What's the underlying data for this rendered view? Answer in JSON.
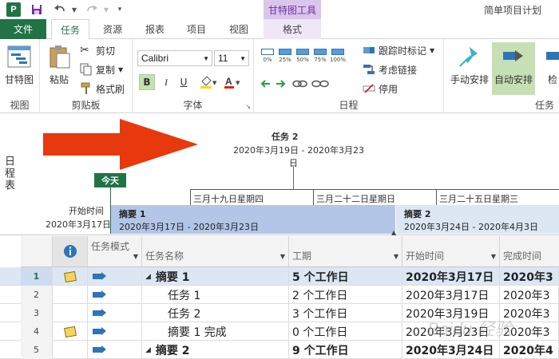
{
  "titlebar": {
    "app_logo": "P",
    "qat_icons": [
      "save-icon",
      "undo-icon",
      "redo-icon",
      "customize-icon"
    ],
    "context_tab_title": "甘特图工具",
    "document_title": "简单项目计划"
  },
  "tabs": {
    "file": "文件",
    "task": "任务",
    "resource": "资源",
    "report": "报表",
    "project": "项目",
    "view": "视图",
    "format": "格式"
  },
  "ribbon": {
    "view_group": {
      "gantt_label": "甘特图",
      "group_label": "视图"
    },
    "clipboard_group": {
      "paste": "粘贴",
      "cut": "剪切",
      "copy": "复制",
      "format_painter": "格式刷",
      "group_label": "剪贴板"
    },
    "font_group": {
      "font_name": "Calibri",
      "font_size": "11",
      "bold": "B",
      "italic": "I",
      "underline": "U",
      "group_label": "字体"
    },
    "schedule_group": {
      "percents": [
        "0%",
        "25%",
        "50%",
        "75%",
        "100%"
      ],
      "track": "跟踪时标记",
      "respect_links": "考虑链接",
      "inactivate": "停用",
      "group_label": "日程"
    },
    "tasks_group": {
      "manual": "手动安排",
      "auto": "自动安排",
      "inspect": "检",
      "group_label": "任务"
    }
  },
  "timeline": {
    "side_label": "日程表",
    "task2_title": "任务 2",
    "task2_dates": "2020年3月19日 - 2020年3月23",
    "task2_day": "日",
    "today": "今天",
    "start_label": "开始时间",
    "start_date": "2020年3月17日",
    "scale_ticks": [
      "三月十九日星期四",
      "三月二十二日星期日",
      "三月二十五日星期三"
    ],
    "summary1": {
      "title": "摘要 1",
      "dates": "2020年3月17日 - 2020年3月23日"
    },
    "summary2": {
      "title": "摘要 2",
      "dates": "2020年3月24日 - 2020年4月3日"
    }
  },
  "grid": {
    "headers": {
      "mode": "任务模式",
      "name": "任务名称",
      "duration": "工期",
      "start": "开始时间",
      "finish": "完成时间"
    },
    "rows": [
      {
        "num": "1",
        "note": true,
        "name": "摘要 1",
        "summary": true,
        "duration": "5 个工作日",
        "start": "2020年3月17日",
        "finish": "2020年3"
      },
      {
        "num": "2",
        "note": false,
        "name": "任务 1",
        "summary": false,
        "duration": "2 个工作日",
        "start": "2020年3月17日",
        "finish": "2020年3"
      },
      {
        "num": "3",
        "note": false,
        "name": "任务 2",
        "summary": false,
        "duration": "3 个工作日",
        "start": "2020年3月19日",
        "finish": "2020年3"
      },
      {
        "num": "4",
        "note": true,
        "name": "摘要 1 完成",
        "summary": false,
        "duration": "0 个工作日",
        "start": "2020年3月23日",
        "finish": "2020年3"
      },
      {
        "num": "5",
        "note": false,
        "name": "摘要 2",
        "summary": true,
        "duration": "9 个工作日",
        "start": "2020年3月24日",
        "finish": "2020年4"
      }
    ]
  },
  "watermark": "Baidu 经验",
  "colors": {
    "accent": "#217346",
    "context": "#7030a0",
    "summary_bar": "#b4c6e7",
    "arrow": "#e8380d"
  }
}
